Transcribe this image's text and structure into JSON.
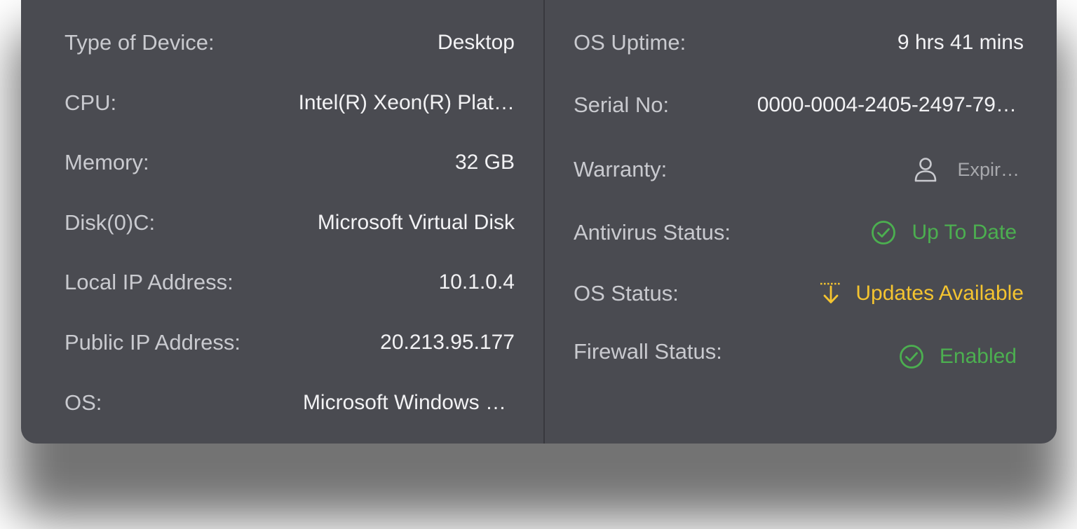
{
  "device": {
    "left": [
      {
        "label": "Type of Device:",
        "value": "Desktop"
      },
      {
        "label": "CPU:",
        "value": "Intel(R) Xeon(R) Plat…"
      },
      {
        "label": "Memory:",
        "value": "32 GB"
      },
      {
        "label": "Disk(0)C:",
        "value": "Microsoft Virtual Disk"
      },
      {
        "label": "Local IP Address:",
        "value": "10.1.0.4"
      },
      {
        "label": "Public IP Address:",
        "value": "20.213.95.177"
      },
      {
        "label": "OS:",
        "value": "Microsoft Windows …"
      }
    ],
    "right": [
      {
        "label": "OS Uptime:",
        "value": "9 hrs 41 mins"
      },
      {
        "label": "Serial No:",
        "value": "0000-0004-2405-2497-79…"
      },
      {
        "label": "Warranty:",
        "value": "Expir…",
        "icon": "user-icon"
      },
      {
        "label": "Antivirus Status:",
        "value": "Up To Date",
        "icon": "check-circle-icon",
        "color": "#4caf50"
      },
      {
        "label": "OS Status:",
        "value": "Updates Available",
        "icon": "download-arrow-icon",
        "color": "#f4c430"
      },
      {
        "label": "Firewall Status:",
        "value": "Enabled",
        "icon": "check-circle-icon",
        "color": "#4caf50"
      }
    ]
  },
  "colors": {
    "card_background": "#4a4b51",
    "divider": "#39393e",
    "label": "#c9cacf",
    "value": "#f2f2f4",
    "ok": "#4caf50",
    "warn": "#f4c430"
  }
}
